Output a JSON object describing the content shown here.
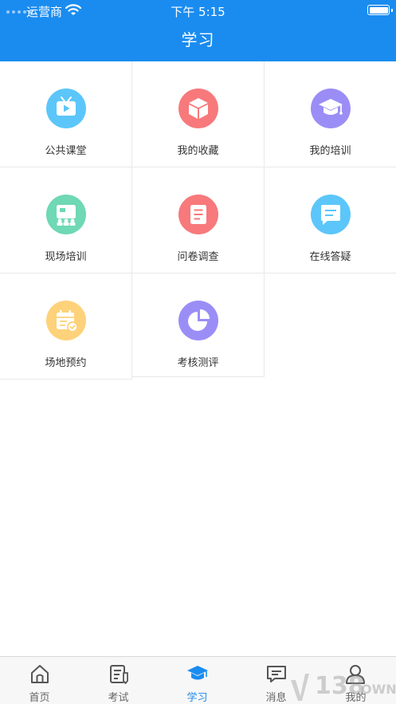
{
  "status_bar": {
    "carrier": "运营商",
    "time": "下午 5:15"
  },
  "navbar": {
    "title": "学习"
  },
  "grid": {
    "items": [
      {
        "label": "公共课堂",
        "icon": "tv-icon",
        "color": "#5cc6fa"
      },
      {
        "label": "我的收藏",
        "icon": "box-icon",
        "color": "#f7797b"
      },
      {
        "label": "我的培训",
        "icon": "graduation-cap-icon",
        "color": "#9a8ef6"
      },
      {
        "label": "现场培训",
        "icon": "presentation-board-icon",
        "color": "#6fd8b4"
      },
      {
        "label": "问卷调查",
        "icon": "document-icon",
        "color": "#f7797b"
      },
      {
        "label": "在线答疑",
        "icon": "chat-icon",
        "color": "#5cc6fa"
      },
      {
        "label": "场地预约",
        "icon": "calendar-check-icon",
        "color": "#fdd27a"
      },
      {
        "label": "考核测评",
        "icon": "pie-chart-icon",
        "color": "#9a8ef6"
      }
    ]
  },
  "tab_bar": {
    "active_color": "#1a8cf0",
    "tabs": [
      {
        "label": "首页",
        "icon": "home-icon"
      },
      {
        "label": "考试",
        "icon": "exam-icon"
      },
      {
        "label": "学习",
        "icon": "study-cap-icon",
        "active": true
      },
      {
        "label": "消息",
        "icon": "message-icon"
      },
      {
        "label": "我的",
        "icon": "profile-icon"
      }
    ]
  },
  "watermark": {
    "text": "138DOWN"
  }
}
